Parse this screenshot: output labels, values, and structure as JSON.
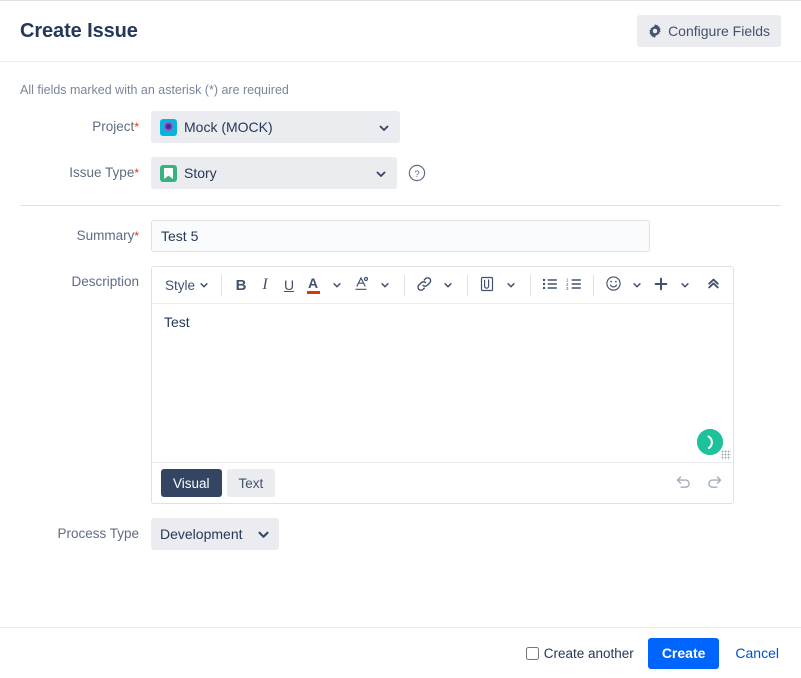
{
  "header": {
    "title": "Create Issue",
    "configure_fields_label": "Configure Fields"
  },
  "body": {
    "required_note": "All fields marked with an asterisk (*) are required"
  },
  "fields": {
    "project": {
      "label": "Project",
      "required_mark": "*",
      "value": "Mock (MOCK)"
    },
    "issue_type": {
      "label": "Issue Type",
      "required_mark": "*",
      "value": "Story"
    },
    "summary": {
      "label": "Summary",
      "required_mark": "*",
      "value": "Test 5",
      "placeholder": ""
    },
    "description": {
      "label": "Description",
      "value": "Test"
    },
    "process_type": {
      "label": "Process Type",
      "value": "Development"
    }
  },
  "editor": {
    "toolbar": {
      "style_label": "Style",
      "bold_label": "B",
      "italic_label": "I",
      "underline_label": "U",
      "text_color_label": "A"
    },
    "modes": {
      "visual": "Visual",
      "text": "Text"
    }
  },
  "footer": {
    "create_another_label": "Create another",
    "create_label": "Create",
    "cancel_label": "Cancel"
  },
  "colors": {
    "primary_button": "#0065ff",
    "link": "#0052cc",
    "required_asterisk": "#de350b",
    "annotation_arrow": "#ff0000",
    "story_icon": "#36b37e",
    "project_icon": "#00b8d9",
    "help_bubble": "#1ec29a",
    "active_tab": "#344563"
  }
}
